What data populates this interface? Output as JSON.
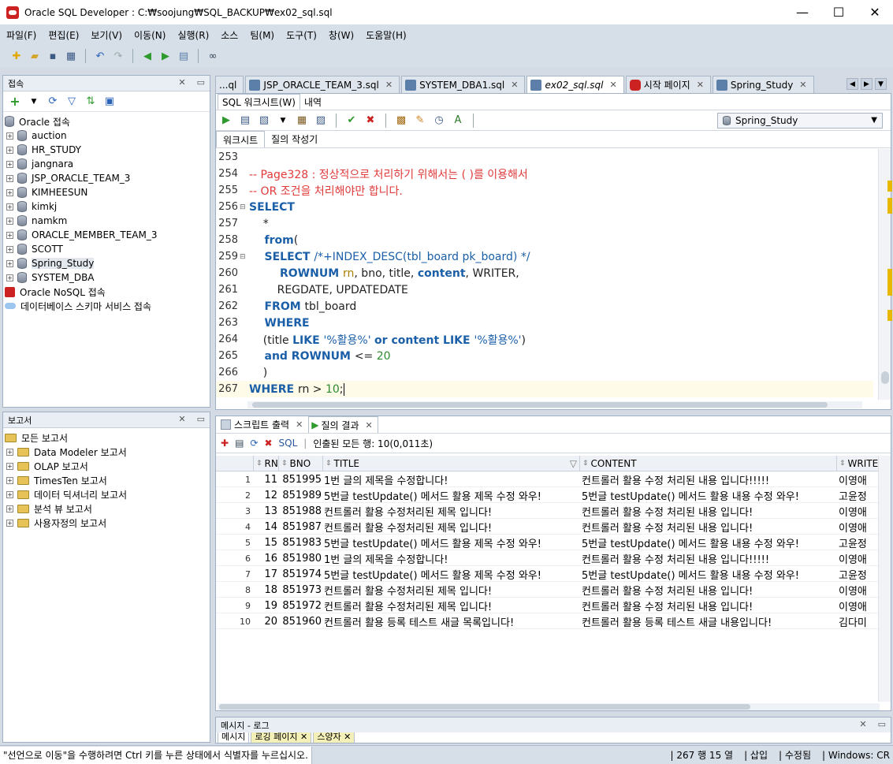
{
  "window": {
    "title": "Oracle SQL Developer : C:₩soojung₩SQL_BACKUP₩ex02_sql.sql",
    "minimize": "—",
    "maximize": "☐",
    "close": "✕"
  },
  "menu": [
    "파일(F)",
    "편집(E)",
    "보기(V)",
    "이동(N)",
    "실행(R)",
    "소스",
    "팀(M)",
    "도구(T)",
    "창(W)",
    "도움말(H)"
  ],
  "connections": {
    "header": "접속",
    "root": "Oracle 접속",
    "items": [
      "auction",
      "HR_STUDY",
      "jangnara",
      "JSP_ORACLE_TEAM_3",
      "KIMHEESUN",
      "kimkj",
      "namkm",
      "ORACLE_MEMBER_TEAM_3",
      "SCOTT",
      "Spring_Study",
      "SYSTEM_DBA"
    ],
    "nosql": "Oracle NoSQL 접속",
    "schema_service": "데이터베이스 스키마 서비스 접속"
  },
  "reports": {
    "header": "보고서",
    "root": "모든 보고서",
    "items": [
      "Data Modeler 보고서",
      "OLAP 보고서",
      "TimesTen 보고서",
      "데이터 딕셔너리 보고서",
      "분석 뷰 보고서",
      "사용자정의 보고서"
    ]
  },
  "doc_tabs": [
    {
      "label": "...ql",
      "icon": false,
      "close": false
    },
    {
      "label": "JSP_ORACLE_TEAM_3.sql",
      "icon": true,
      "close": true
    },
    {
      "label": "SYSTEM_DBA1.sql",
      "icon": true,
      "close": true
    },
    {
      "label": "ex02_sql.sql",
      "icon": true,
      "close": true,
      "active": true
    },
    {
      "label": "시작 페이지",
      "icon": true,
      "close": true,
      "oracle": true
    },
    {
      "label": "Spring_Study",
      "icon": true,
      "close": true
    }
  ],
  "editor": {
    "tab_worksheet": "SQL 워크시트(W)",
    "tab_history": "내역",
    "connection": "Spring_Study",
    "inner_tab_worksheet": "워크시트",
    "inner_tab_builder": "질의 작성기"
  },
  "code_lines": [
    {
      "n": "253",
      "fold": "",
      "tokens": []
    },
    {
      "n": "254",
      "fold": "",
      "tokens": [
        {
          "c": "cm",
          "t": "-- Page328 : 정상적으로 처리하기 위해서는 ( )를 이용해서"
        }
      ]
    },
    {
      "n": "255",
      "fold": "",
      "tokens": [
        {
          "c": "cm",
          "t": "-- OR 조건을 처리해야만 합니다."
        }
      ]
    },
    {
      "n": "256",
      "fold": "⊟",
      "tokens": [
        {
          "c": "kw",
          "t": "SELECT"
        }
      ]
    },
    {
      "n": "257",
      "fold": "",
      "tokens": [
        {
          "c": "plain",
          "t": "    *"
        }
      ]
    },
    {
      "n": "258",
      "fold": "",
      "tokens": [
        {
          "c": "kw",
          "t": "    from"
        },
        {
          "c": "plain",
          "t": "("
        }
      ]
    },
    {
      "n": "259",
      "fold": "⊟",
      "tokens": [
        {
          "c": "kw",
          "t": "    SELECT "
        },
        {
          "c": "str",
          "t": "/*+INDEX_DESC(tbl_board pk_board) */"
        }
      ]
    },
    {
      "n": "260",
      "fold": "",
      "tokens": [
        {
          "c": "kw",
          "t": "        ROWNUM "
        },
        {
          "c": "ident",
          "t": "rn"
        },
        {
          "c": "plain",
          "t": ", bno, title, "
        },
        {
          "c": "kw",
          "t": "content"
        },
        {
          "c": "plain",
          "t": ", WRITER,"
        }
      ]
    },
    {
      "n": "261",
      "fold": "",
      "tokens": [
        {
          "c": "plain",
          "t": "        REGDATE, UPDATEDATE"
        }
      ]
    },
    {
      "n": "262",
      "fold": "",
      "tokens": [
        {
          "c": "kw",
          "t": "    FROM "
        },
        {
          "c": "plain",
          "t": "tbl_board"
        }
      ]
    },
    {
      "n": "263",
      "fold": "",
      "tokens": [
        {
          "c": "kw",
          "t": "    WHERE"
        }
      ]
    },
    {
      "n": "264",
      "fold": "",
      "tokens": [
        {
          "c": "plain",
          "t": "    (title "
        },
        {
          "c": "kw",
          "t": "LIKE "
        },
        {
          "c": "str",
          "t": "'%활용%' "
        },
        {
          "c": "kw",
          "t": "or "
        },
        {
          "c": "kw",
          "t": "content LIKE "
        },
        {
          "c": "str",
          "t": "'%활용%'"
        },
        {
          "c": "plain",
          "t": ")"
        }
      ]
    },
    {
      "n": "265",
      "fold": "",
      "tokens": [
        {
          "c": "kw",
          "t": "    and ROWNUM "
        },
        {
          "c": "plain",
          "t": "<= "
        },
        {
          "c": "num",
          "t": "20"
        }
      ]
    },
    {
      "n": "266",
      "fold": "",
      "tokens": [
        {
          "c": "plain",
          "t": "    )"
        }
      ]
    },
    {
      "n": "267",
      "fold": "",
      "current": true,
      "tokens": [
        {
          "c": "kw",
          "t": "WHERE "
        },
        {
          "c": "plain",
          "t": "rn > "
        },
        {
          "c": "num",
          "t": "10"
        },
        {
          "c": "plain",
          "t": ";"
        }
      ]
    }
  ],
  "results": {
    "tab_script": "스크립트 출력",
    "tab_query": "질의 결과",
    "sql_link": "SQL",
    "fetch_status": "인출된 모든 행: 10(0,011초)",
    "columns": [
      "RN",
      "BNO",
      "TITLE",
      "CONTENT",
      "WRITE"
    ],
    "rows": [
      [
        "1",
        "11",
        "851995",
        "1번 글의 제목을 수정합니다!",
        "컨트롤러 활용 수정 처리된 내용 입니다!!!!!",
        "이영애"
      ],
      [
        "2",
        "12",
        "851989",
        "5번글 testUpdate() 메서드 활용 제목 수정 와우!",
        "5번글 testUpdate() 메서드 활용 내용 수정 와우!",
        "고윤정"
      ],
      [
        "3",
        "13",
        "851988",
        "컨트롤러 활용 수정처리된 제목 입니다!",
        "컨트롤러 활용 수정 처리된 내용 입니다!",
        "이영애"
      ],
      [
        "4",
        "14",
        "851987",
        "컨트롤러 활용 수정처리된 제목 입니다!",
        "컨트롤러 활용 수정 처리된 내용 입니다!",
        "이영애"
      ],
      [
        "5",
        "15",
        "851983",
        "5번글 testUpdate() 메서드 활용 제목 수정 와우!",
        "5번글 testUpdate() 메서드 활용 내용 수정 와우!",
        "고윤정"
      ],
      [
        "6",
        "16",
        "851980",
        "1번 글의 제목을 수정합니다!",
        "컨트롤러 활용 수정 처리된 내용 입니다!!!!!",
        "이영애"
      ],
      [
        "7",
        "17",
        "851974",
        "5번글 testUpdate() 메서드 활용 제목 수정 와우!",
        "5번글 testUpdate() 메서드 활용 내용 수정 와우!",
        "고윤정"
      ],
      [
        "8",
        "18",
        "851973",
        "컨트롤러 활용 수정처리된 제목 입니다!",
        "컨트롤러 활용 수정 처리된 내용 입니다!",
        "이영애"
      ],
      [
        "9",
        "19",
        "851972",
        "컨트롤러 활용 수정처리된 제목 입니다!",
        "컨트롤러 활용 수정 처리된 내용 입니다!",
        "이영애"
      ],
      [
        "10",
        "20",
        "851960",
        "컨트롤러 활용 등록 테스트 새글 목록입니다!",
        "컨트롤러 활용 등록 테스트 새글 내용입니다!",
        "김다미"
      ]
    ]
  },
  "message_log": {
    "header": "메시지 - 로그",
    "tabs": [
      "메시지",
      "로깅 페이지",
      "스양자"
    ]
  },
  "status": {
    "message": "\"선언으로 이동\"을 수행하려면 Ctrl 키를 누른 상태에서 식별자를 누르십시오.",
    "position": "| 267 행 15 열",
    "mode": "| 삽입",
    "modified": "| 수정됨",
    "encoding": "| Windows: CR"
  }
}
